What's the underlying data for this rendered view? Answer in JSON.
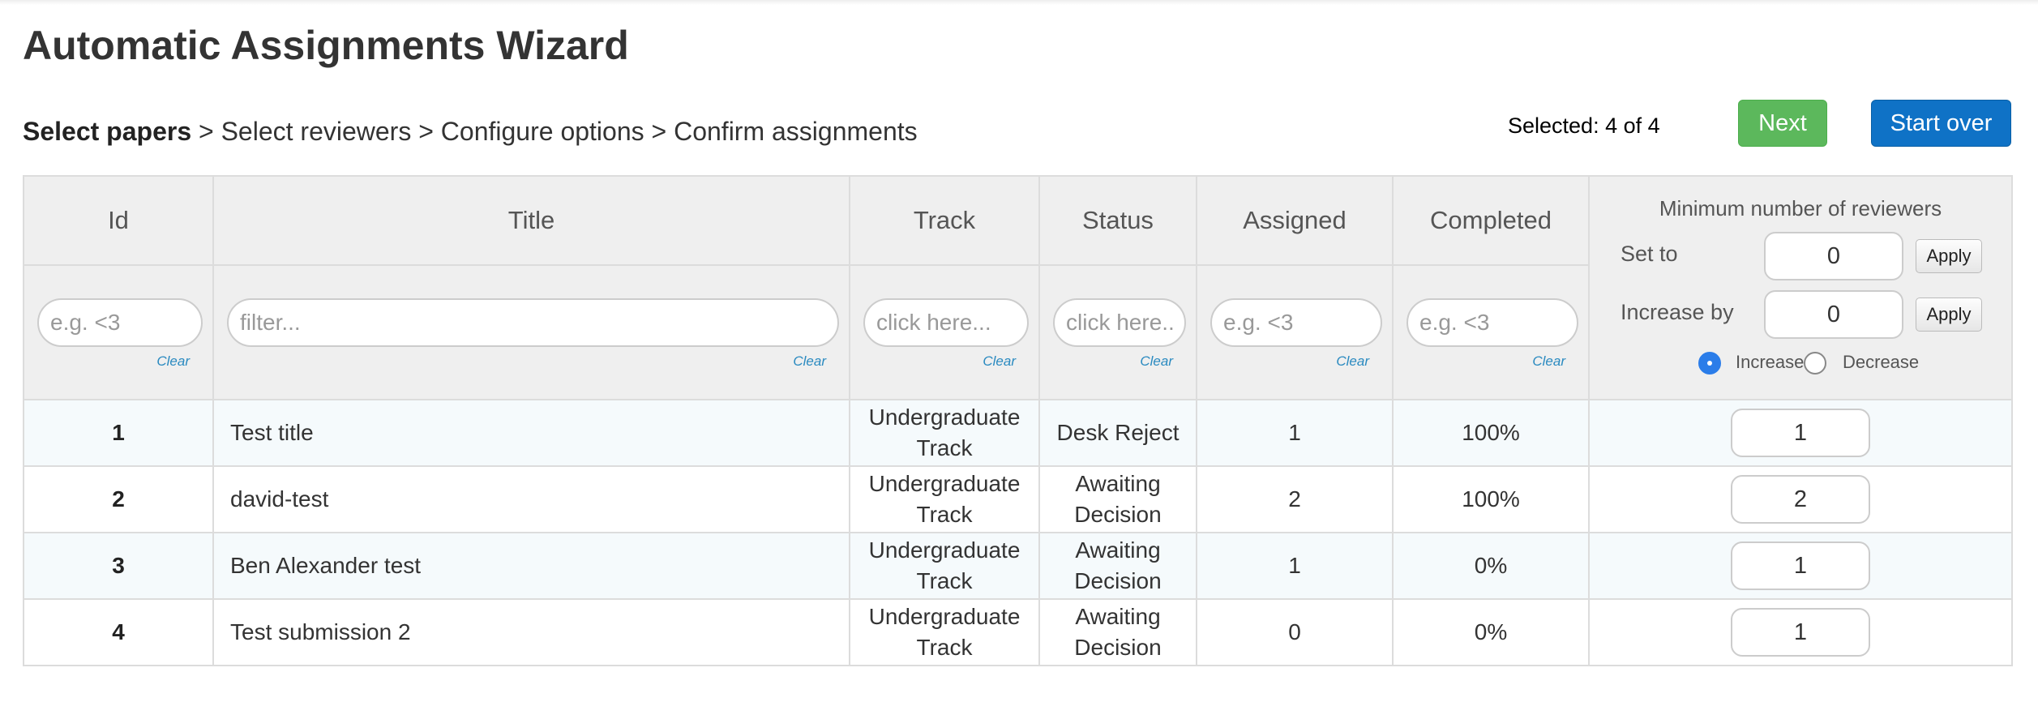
{
  "page": {
    "title": "Automatic Assignments Wizard"
  },
  "breadcrumb": {
    "steps": [
      "Select papers",
      "Select reviewers",
      "Configure options",
      "Confirm assignments"
    ],
    "separator": ">"
  },
  "selection": {
    "text": "Selected: 4 of 4"
  },
  "buttons": {
    "next": "Next",
    "start_over": "Start over"
  },
  "table": {
    "headers": {
      "id": "Id",
      "title": "Title",
      "track": "Track",
      "status": "Status",
      "assigned": "Assigned",
      "completed": "Completed"
    },
    "filters": {
      "id": {
        "placeholder": "e.g. <3",
        "clear": "Clear"
      },
      "title": {
        "placeholder": "filter...",
        "clear": "Clear"
      },
      "track": {
        "placeholder": "click here...",
        "clear": "Clear"
      },
      "status": {
        "placeholder": "click here...",
        "clear": "Clear"
      },
      "assigned": {
        "placeholder": "e.g. <3",
        "clear": "Clear"
      },
      "completed": {
        "placeholder": "e.g. <3",
        "clear": "Clear"
      }
    },
    "min_reviewers": {
      "title": "Minimum number of reviewers",
      "set_to_label": "Set to",
      "set_to_value": "0",
      "increase_by_label": "Increase by",
      "increase_by_value": "0",
      "apply_label": "Apply",
      "increase_label": "Increase",
      "decrease_label": "Decrease",
      "selected_mode": "Increase"
    },
    "rows": [
      {
        "id": "1",
        "title": "Test title",
        "track": "Undergraduate Track",
        "status": "Desk Reject",
        "assigned": "1",
        "completed": "100%",
        "min_reviewers": "1"
      },
      {
        "id": "2",
        "title": "david-test",
        "track": "Undergraduate Track",
        "status": "Awaiting Decision",
        "assigned": "2",
        "completed": "100%",
        "min_reviewers": "2"
      },
      {
        "id": "3",
        "title": "Ben Alexander test",
        "track": "Undergraduate Track",
        "status": "Awaiting Decision",
        "assigned": "1",
        "completed": "0%",
        "min_reviewers": "1"
      },
      {
        "id": "4",
        "title": "Test submission 2",
        "track": "Undergraduate Track",
        "status": "Awaiting Decision",
        "assigned": "0",
        "completed": "0%",
        "min_reviewers": "1"
      }
    ]
  },
  "colors": {
    "next_button": "#5cb85c",
    "start_over_button": "#0f72c6",
    "radio_selected": "#2b7de9",
    "link": "#2a8ac0"
  }
}
